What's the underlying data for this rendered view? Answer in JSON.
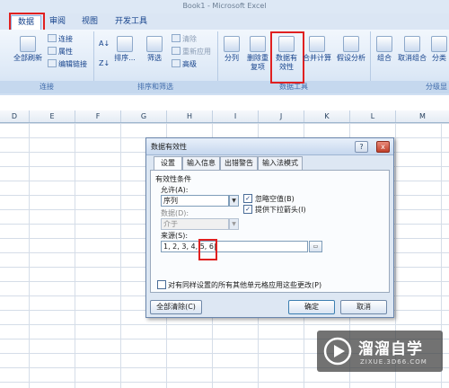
{
  "app": {
    "title": "Book1 - Microsoft Excel"
  },
  "ribbon": {
    "tabs": [
      "数据",
      "审阅",
      "视图",
      "开发工具"
    ],
    "active_tab": "数据",
    "groups": {
      "connections": {
        "label": "连接",
        "refresh_all": "全部刷新",
        "connections": "连接",
        "properties": "属性",
        "edit_links": "编辑链接"
      },
      "sort_filter": {
        "label": "排序和筛选",
        "sort": "排序...",
        "filter": "筛选",
        "clear": "清除",
        "reapply": "重新应用",
        "advanced": "高级"
      },
      "data_tools": {
        "label": "数据工具",
        "text_to_columns": "分列",
        "remove_duplicates": "删除重复项",
        "data_validation": "数据有效性",
        "consolidate": "合并计算",
        "what_if": "假设分析"
      },
      "outline": {
        "label": "分级显",
        "group": "组合",
        "ungroup": "取消组合",
        "subtotal": "分类"
      }
    }
  },
  "sheet": {
    "columns": [
      "D",
      "E",
      "F",
      "G",
      "H",
      "I",
      "J",
      "K",
      "L",
      "M"
    ]
  },
  "dialog": {
    "title": "数据有效性",
    "help": "?",
    "close": "x",
    "tabs": [
      "设置",
      "输入信息",
      "出错警告",
      "输入法模式"
    ],
    "active_tab": "设置",
    "criteria_heading": "有效性条件",
    "allow_label": "允许(A):",
    "allow_value": "序列",
    "ignore_blank": "忽略空值(B)",
    "in_cell_dropdown": "提供下拉箭头(I)",
    "data_label": "数据(D):",
    "data_value": "介于",
    "source_label": "来源(S):",
    "source_value": "1, 2, 3, 4, 5, 6|",
    "apply_all": "对有同样设置的所有其他单元格应用这些更改(P)",
    "clear_all": "全部清除(C)",
    "ok": "确定",
    "cancel": "取消"
  },
  "watermark": {
    "brand": "溜溜自学",
    "url": "ZIXUE.3D66.COM"
  }
}
